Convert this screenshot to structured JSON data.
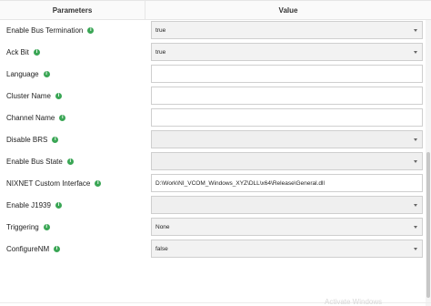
{
  "header": {
    "parameters_label": "Parameters",
    "value_label": "Value"
  },
  "rows": [
    {
      "label": "Enable Bus Termination",
      "type": "select",
      "value": "true"
    },
    {
      "label": "Ack Bit",
      "type": "select",
      "value": "true"
    },
    {
      "label": "Language",
      "type": "text",
      "value": ""
    },
    {
      "label": "Cluster Name",
      "type": "text",
      "value": ""
    },
    {
      "label": "Channel Name",
      "type": "text",
      "value": ""
    },
    {
      "label": "Disable BRS",
      "type": "select",
      "value": ""
    },
    {
      "label": "Enable Bus State",
      "type": "select",
      "value": ""
    },
    {
      "label": "NIXNET Custom Interface",
      "type": "text",
      "value": "D:\\Work\\NI_VCOM_Windows_XYZ\\DLL\\x64\\Release\\General.dll"
    },
    {
      "label": "Enable J1939",
      "type": "select",
      "value": ""
    },
    {
      "label": "Triggering",
      "type": "select",
      "value": "None"
    },
    {
      "label": "ConfigureNM",
      "type": "select",
      "value": "false"
    }
  ],
  "info_glyph": "i",
  "watermark": "Activate Windows",
  "colors": {
    "info": "#3aa655",
    "border": "#cfcfcf",
    "select_bg": "#f2f2f2"
  }
}
